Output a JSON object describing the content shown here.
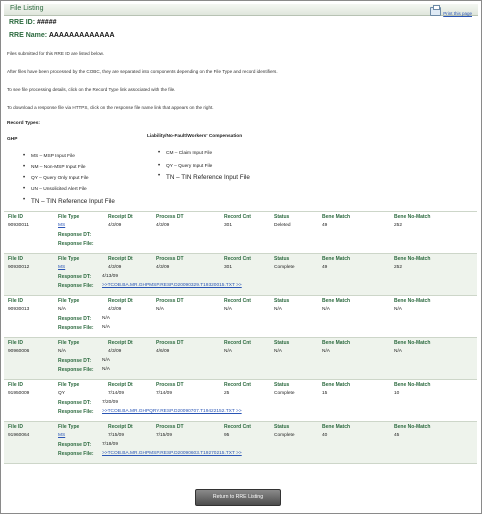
{
  "header": {
    "title": "File Listing",
    "print_label": "Print this page"
  },
  "rre": {
    "id_label": "RRE ID:",
    "id_value": "#####",
    "name_label": "RRE Name:",
    "name_value": "AAAAAAAAAAAAA"
  },
  "intro": [
    "Files submitted for this RRE ID are listed below.",
    "After files have been processed by the COBC, they are separated into components depending on the File Type and record identifiers.",
    "To see file processing details, click on the Record Type link associated with the file.",
    "To download a response file via HTTPS, click on the response file name link that appears on the right."
  ],
  "record_types": {
    "heading": "Record Types:",
    "ghp_heading": "GHP",
    "ghp_items": [
      "MS – MSP Input File",
      "NM – Non-MSP Input File",
      "QY – Query Only Input File",
      "UN – Unsolicited Alert File",
      "TN – TIN Reference Input File"
    ],
    "liability_heading": "Liability/No-Fault/Workers' Compensation",
    "liability_items": [
      "CM – Claim Input File",
      "QY – Query Input File",
      "TN – TIN Reference Input File"
    ]
  },
  "columns": {
    "file_id": "File ID",
    "file_type": "File Type",
    "receipt_dt": "Receipt Dt",
    "process_dt": "Process DT",
    "record_cnt": "Record Cnt",
    "status": "Status",
    "bene_match": "Bene Match",
    "bene_no_match": "Bene No-Match",
    "response_dt": "Response DT:",
    "response_file": "Response File:"
  },
  "files": [
    {
      "file_id": "90930011",
      "file_type": "MS",
      "receipt_dt": "4/3/09",
      "process_dt": "4/3/09",
      "record_cnt": "301",
      "status": "Deleted",
      "bene_match": "49",
      "bene_no_match": "252",
      "response_dt": "",
      "response_file": ""
    },
    {
      "file_id": "90930012",
      "file_type": "MS",
      "receipt_dt": "4/3/09",
      "process_dt": "4/3/09",
      "record_cnt": "301",
      "status": "Complete",
      "bene_match": "49",
      "bene_no_match": "252",
      "response_dt": "4/13/09",
      "response_file": ">>TCOB.BA.MR.GHPMSP.RESP.D20090329.T19320015.TXT >>"
    },
    {
      "file_id": "90930013",
      "file_type": "N/A",
      "receipt_dt": "4/3/09",
      "process_dt": "N/A",
      "record_cnt": "N/A",
      "status": "N/A",
      "bene_match": "N/A",
      "bene_no_match": "N/A",
      "response_dt": "N/A",
      "response_file": "N/A"
    },
    {
      "file_id": "90960006",
      "file_type": "N/A",
      "receipt_dt": "4/3/09",
      "process_dt": "4/6/09",
      "record_cnt": "N/A",
      "status": "N/A",
      "bene_match": "N/A",
      "bene_no_match": "N/A",
      "response_dt": "N/A",
      "response_file": "N/A"
    },
    {
      "file_id": "91950009",
      "file_type": "QY",
      "receipt_dt": "7/14/09",
      "process_dt": "7/14/09",
      "record_cnt": "25",
      "status": "Complete",
      "bene_match": "15",
      "bene_no_match": "10",
      "response_dt": "7/20/09",
      "response_file": ">>TCOB.BA.MR.GHPQRY.RESP.D20090707.T19422152.TXT >>"
    },
    {
      "file_id": "91960064",
      "file_type": "MS",
      "receipt_dt": "7/15/09",
      "process_dt": "7/15/09",
      "record_cnt": "95",
      "status": "Complete",
      "bene_match": "40",
      "bene_no_match": "45",
      "response_dt": "7/18/09",
      "response_file": ">>TCOB.BA.MR.GHPMSP.RESP.D20090603.T19270215.TXT >>"
    }
  ],
  "return_button": "Return to RRE Listing",
  "colors": {
    "accent": "#2c6a3f",
    "link": "#2a55b5",
    "row_alt": "#eef3ec"
  }
}
